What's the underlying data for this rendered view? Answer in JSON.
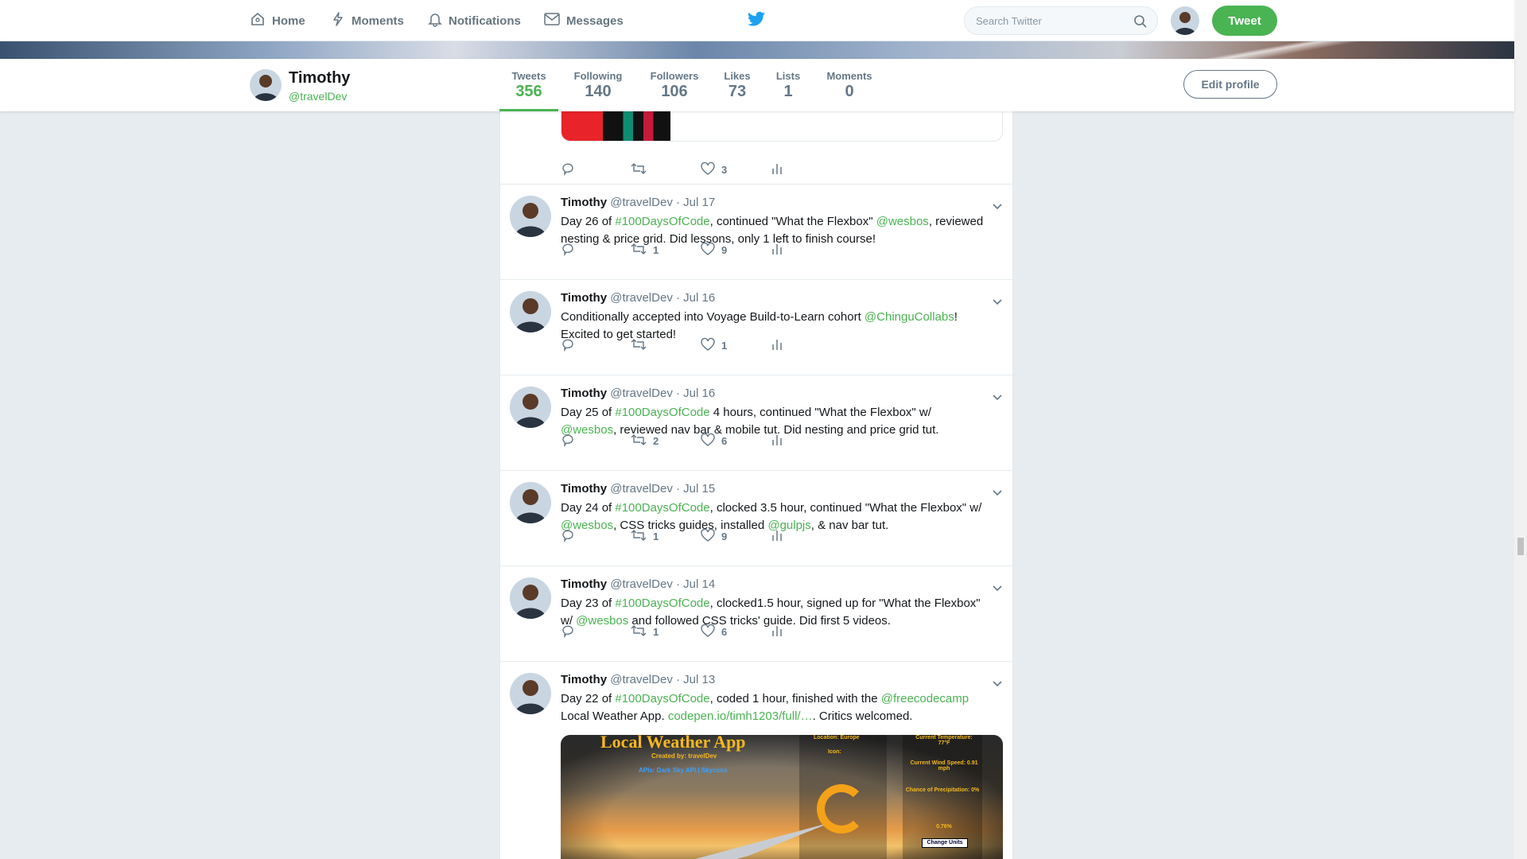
{
  "nav": {
    "home": "Home",
    "moments": "Moments",
    "notifications": "Notifications",
    "messages": "Messages",
    "search_placeholder": "Search Twitter",
    "tweet_button": "Tweet"
  },
  "colors": {
    "accent": "#4ab352",
    "text": "#14171a",
    "muted": "#657786",
    "background": "#e6ecf0"
  },
  "profile": {
    "name": "Timothy",
    "handle": "@travelDev",
    "stats": [
      {
        "label": "Tweets",
        "value": "356"
      },
      {
        "label": "Following",
        "value": "140"
      },
      {
        "label": "Followers",
        "value": "106"
      },
      {
        "label": "Likes",
        "value": "73"
      },
      {
        "label": "Lists",
        "value": "1"
      },
      {
        "label": "Moments",
        "value": "0"
      }
    ],
    "edit_button": "Edit profile"
  },
  "first_tweet": {
    "reply": "",
    "retweets": "",
    "likes": "3"
  },
  "tweets": [
    {
      "name": "Timothy",
      "handle": "@travelDev",
      "date": "· Jul 17",
      "text": [
        {
          "t": "Day 26 of "
        },
        {
          "t": "#100DaysOfCode",
          "link": true
        },
        {
          "t": ", continued \"What the Flexbox\" "
        },
        {
          "t": "@wesbos",
          "link": true
        },
        {
          "t": ", reviewed nesting & price grid. Did lessons, only 1 left to finish course!"
        }
      ],
      "retweets": "1",
      "likes": "9"
    },
    {
      "name": "Timothy",
      "handle": "@travelDev",
      "date": "· Jul 16",
      "text": [
        {
          "t": "Conditionally accepted into Voyage Build-to-Learn cohort "
        },
        {
          "t": "@ChinguCollabs",
          "link": true
        },
        {
          "t": "! Excited to get started!"
        }
      ],
      "retweets": "",
      "likes": "1"
    },
    {
      "name": "Timothy",
      "handle": "@travelDev",
      "date": "· Jul 16",
      "text": [
        {
          "t": "Day 25 of "
        },
        {
          "t": "#100DaysOfCode",
          "link": true
        },
        {
          "t": " 4 hours, continued \"What the Flexbox\" w/ "
        },
        {
          "t": "@wesbos",
          "link": true
        },
        {
          "t": ", reviewed nav bar & mobile tut. Did nesting and price grid tut."
        }
      ],
      "retweets": "2",
      "likes": "6"
    },
    {
      "name": "Timothy",
      "handle": "@travelDev",
      "date": "· Jul 15",
      "text": [
        {
          "t": "Day 24 of "
        },
        {
          "t": "#100DaysOfCode",
          "link": true
        },
        {
          "t": ", clocked 3.5 hour, continued \"What the Flexbox\" w/ "
        },
        {
          "t": "@wesbos",
          "link": true
        },
        {
          "t": ", CSS tricks guides, installed "
        },
        {
          "t": "@gulpjs",
          "link": true
        },
        {
          "t": ", & nav bar tut."
        }
      ],
      "retweets": "1",
      "likes": "9"
    },
    {
      "name": "Timothy",
      "handle": "@travelDev",
      "date": "· Jul 14",
      "text": [
        {
          "t": "Day 23 of "
        },
        {
          "t": "#100DaysOfCode",
          "link": true
        },
        {
          "t": ", clocked1.5 hour, signed up for \"What the Flexbox\" w/ "
        },
        {
          "t": "@wesbos",
          "link": true
        },
        {
          "t": " and followed CSS tricks' guide. Did first 5 videos."
        }
      ],
      "retweets": "1",
      "likes": "6"
    },
    {
      "name": "Timothy",
      "handle": "@travelDev",
      "date": "· Jul 13",
      "text": [
        {
          "t": "Day 22 of "
        },
        {
          "t": "#100DaysOfCode",
          "link": true
        },
        {
          "t": ", coded 1 hour, finished with the "
        },
        {
          "t": "@freecodecamp",
          "link": true
        },
        {
          "t": " Local Weather App. "
        },
        {
          "t": "codepen.io/timh1203/full/…",
          "link": true
        },
        {
          "t": ". Critics welcomed."
        }
      ],
      "retweets": "",
      "likes": ""
    }
  ],
  "weather_card": {
    "title": "Local Weather App",
    "created_by": "Created by: travelDev",
    "apis": "APIs: Dark Sky API | Skycons",
    "icon_label": "Icon:",
    "location_label": "Location: Europe",
    "temp_label": "Current Temperature: 77°F",
    "wind_label": "Current Wind Speed: 0.91 mph",
    "precip_label": "Chance of Precipitation: 0%",
    "humidity_value": "0.76%",
    "units_button": "Change Units"
  }
}
